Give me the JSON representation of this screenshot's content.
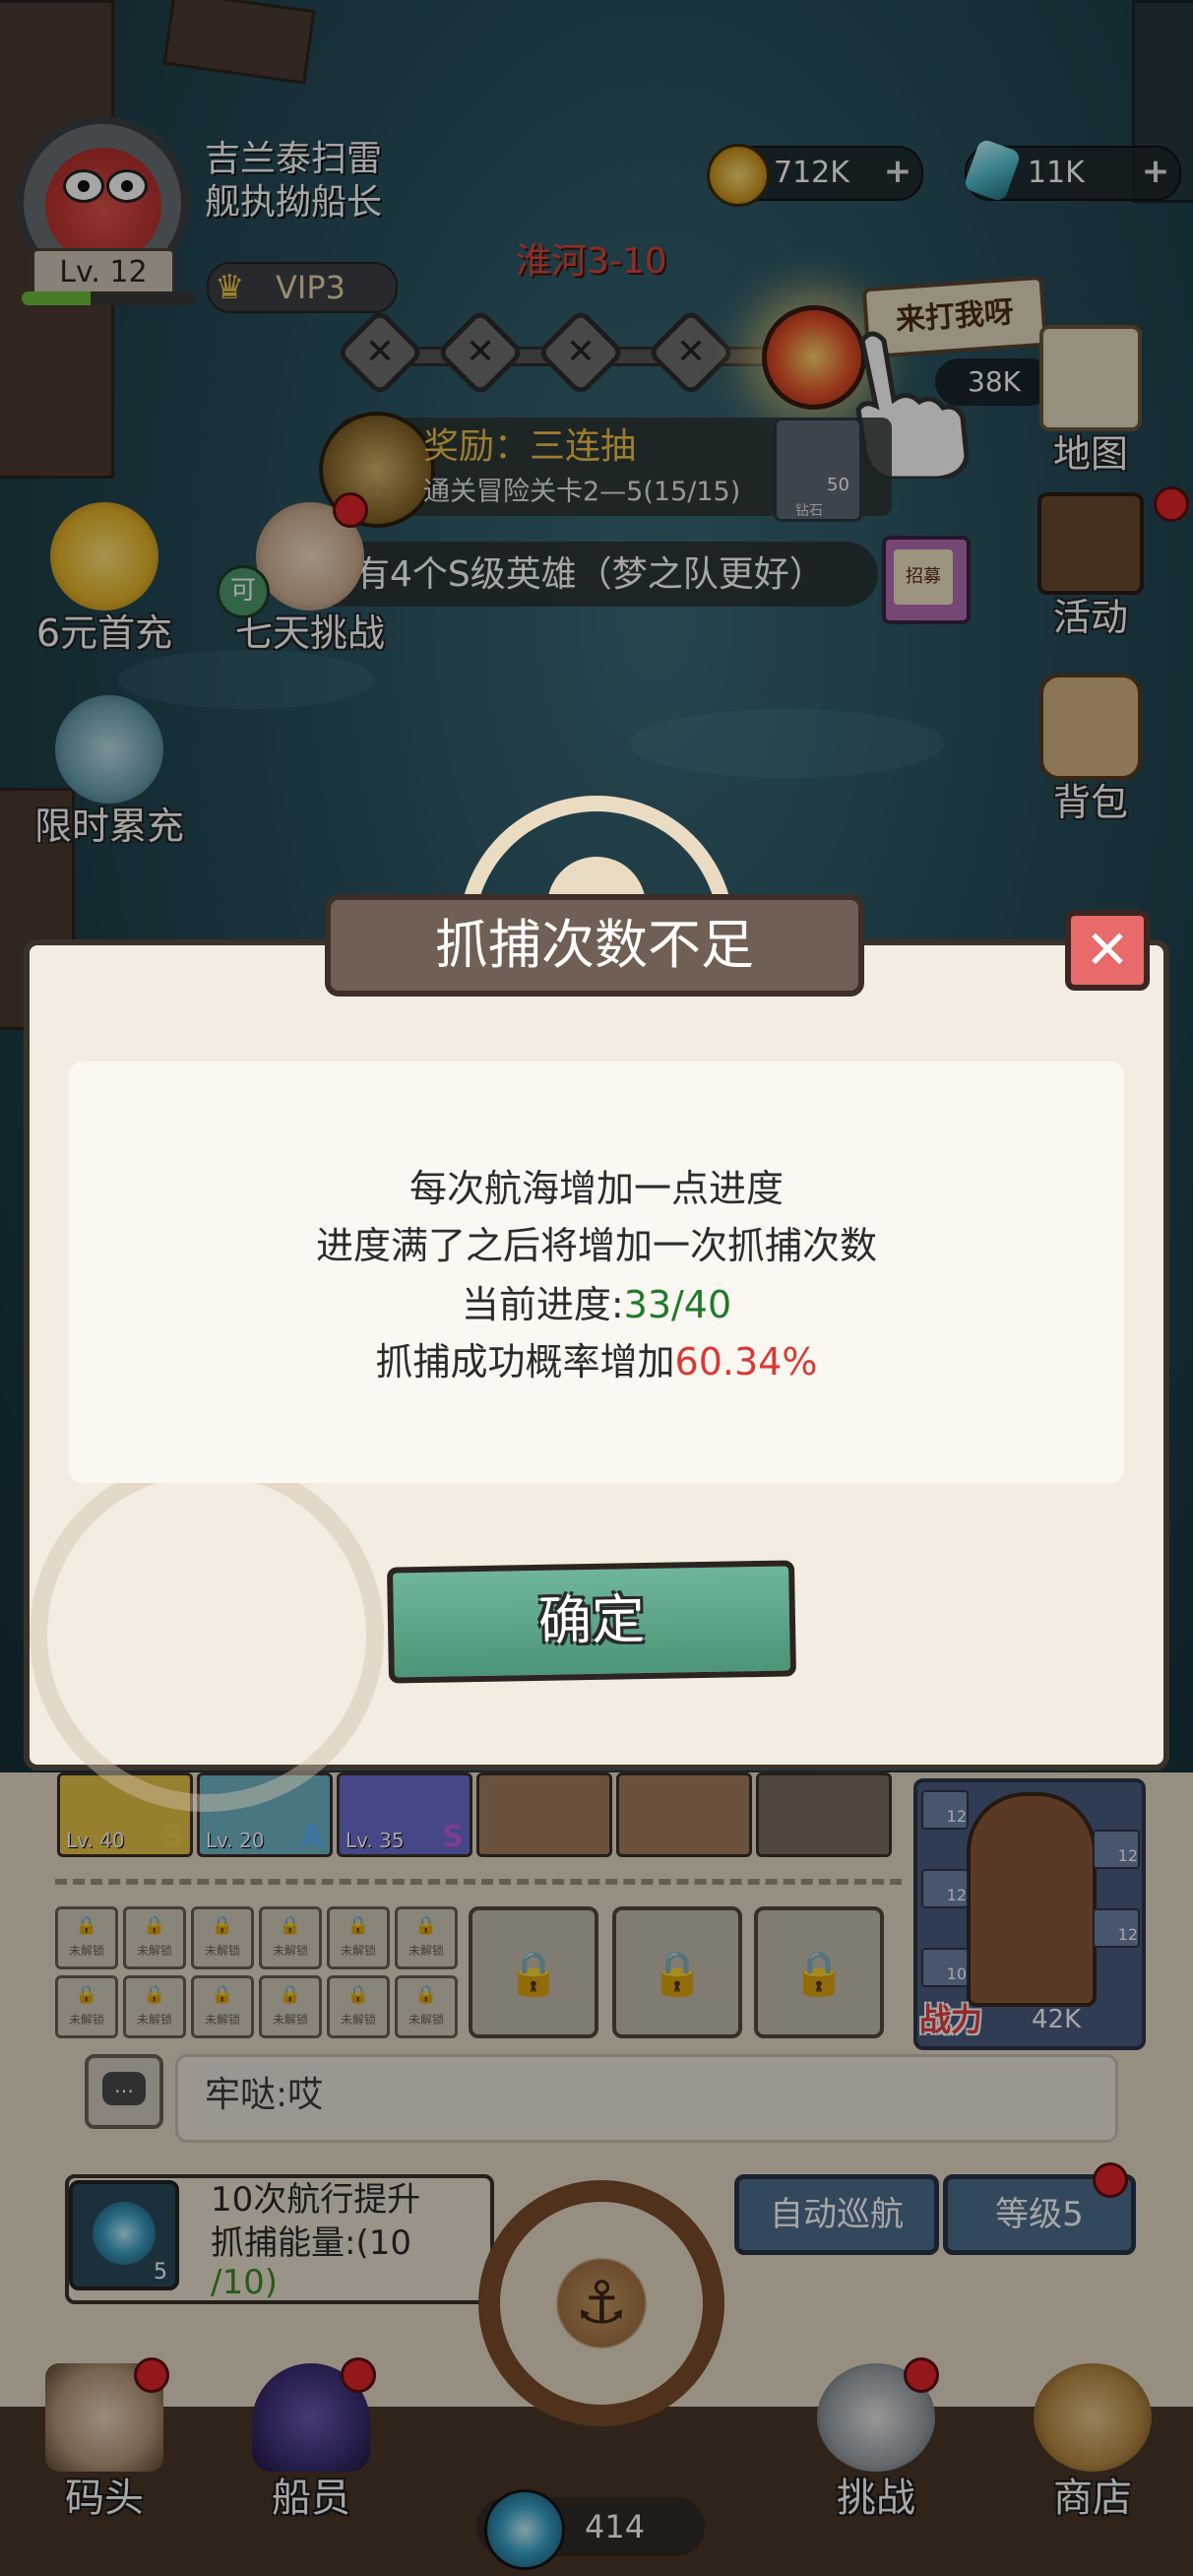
{
  "player": {
    "name_line1": "吉兰泰扫雷",
    "name_line2": "舰执拗船长",
    "level_label": "Lv. 12",
    "level_progress": 0.4,
    "vip": "VIP3"
  },
  "resources": {
    "gold": "712K",
    "gems": "11K",
    "gold_icon": "gold-coin-icon",
    "gem_icon": "crystal-icon"
  },
  "stage": {
    "name": "淮河3-10",
    "boss_tag": "来打我呀",
    "boss_power": "38K"
  },
  "reward": {
    "title": "奖励：三连抽",
    "subtitle": "通关冒险关卡2—5(15/15)",
    "gem_count": "50",
    "gem_label": "钻石"
  },
  "task": {
    "text": "有4个S级英雄（梦之队更好）",
    "scroll_label": "招募"
  },
  "side_left": {
    "first_charge": "6元首充",
    "seven_day": "七天挑战",
    "seven_day_badge": "可",
    "limited_charge": "限时累充"
  },
  "side_right": {
    "map": "地图",
    "events": "活动",
    "bag": "背包"
  },
  "popup": {
    "title": "抓捕次数不足",
    "line1": "每次航海增加一点进度",
    "line2": "进度满了之后将增加一次抓捕次数",
    "line3_label": "当前进度:",
    "line3_value": "33/40",
    "line4_label": "抓捕成功概率增加",
    "line4_value": "60.34%",
    "confirm": "确定",
    "close_glyph": "✕"
  },
  "heroes": [
    {
      "level": "Lv. 40",
      "rank": "S",
      "color": "#e8c34a",
      "rank_color": "#e7d04a"
    },
    {
      "level": "Lv. 20",
      "rank": "A",
      "color": "#6fb6c7",
      "rank_color": "#5fb1ff"
    },
    {
      "level": "Lv. 35",
      "rank": "S",
      "color": "#6a6ed0",
      "rank_color": "#c05de0"
    }
  ],
  "locked_label": "未解锁",
  "ship": {
    "power_label": "战力",
    "power_value": "42K",
    "slot_levels": [
      "12",
      "12",
      "12",
      "12",
      "10"
    ]
  },
  "chat": {
    "text": "牢哒:哎"
  },
  "quest": {
    "line1": "10次航行提升",
    "line2": "抓捕能量:(10",
    "line3": "/10)",
    "count": "5"
  },
  "buttons": {
    "auto_sail": "自动巡航",
    "level": "等级5"
  },
  "nav": {
    "dock": "码头",
    "crew": "船员",
    "challenge": "挑战",
    "shop": "商店"
  },
  "energy": "414",
  "colors": {
    "popup_bg": "#f3ece0",
    "confirm_green": "#5aa384",
    "progress_green": "#1f7a2a",
    "chance_red": "#d93a33",
    "title_tab": "#6f5f54",
    "close_red": "#e86a6a"
  }
}
